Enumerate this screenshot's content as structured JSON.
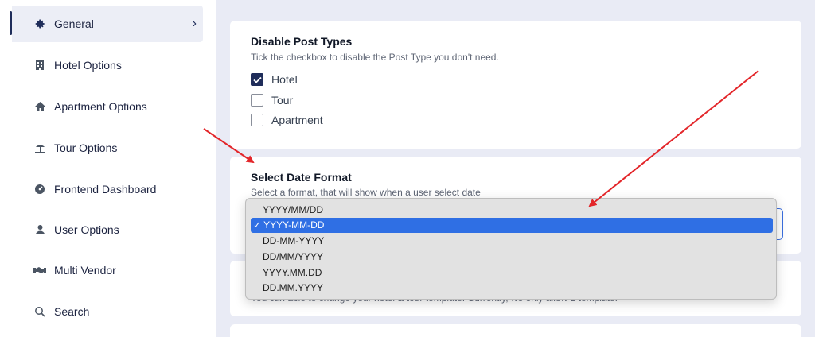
{
  "sidebar": {
    "items": [
      {
        "label": "General",
        "icon": "gear-icon"
      },
      {
        "label": "Hotel Options",
        "icon": "building-icon"
      },
      {
        "label": "Apartment Options",
        "icon": "home-icon"
      },
      {
        "label": "Tour Options",
        "icon": "umbrella-icon"
      },
      {
        "label": "Frontend Dashboard",
        "icon": "dashboard-icon"
      },
      {
        "label": "User Options",
        "icon": "user-icon"
      },
      {
        "label": "Multi Vendor",
        "icon": "handshake-icon"
      },
      {
        "label": "Search",
        "icon": "search-icon"
      }
    ],
    "chevron": "›"
  },
  "post_types": {
    "title": "Disable Post Types",
    "description": "Tick the checkbox to disable the Post Type you don't need.",
    "options": [
      {
        "label": "Hotel",
        "checked": true
      },
      {
        "label": "Tour",
        "checked": false
      },
      {
        "label": "Apartment",
        "checked": false
      }
    ]
  },
  "date_format": {
    "title": "Select Date Format",
    "description": "Select a format, that will show when a user select date",
    "options": [
      "YYYY/MM/DD",
      "✓ YYYY-MM-DD",
      "DD-MM-YYYY",
      "DD/MM/YYYY",
      "YYYY.MM.DD",
      "DD.MM.YYYY"
    ],
    "selected_index": 1
  },
  "template_text": "You can able to change your hotel & tour template. Currently, we only allow 2 template.",
  "colors": {
    "accent": "#1f2d5a",
    "select_focus": "#3b6fe0",
    "dropdown_selected": "#2f6fe4",
    "annotation_arrow": "#e3262a",
    "main_bg": "#e9ebf5"
  }
}
